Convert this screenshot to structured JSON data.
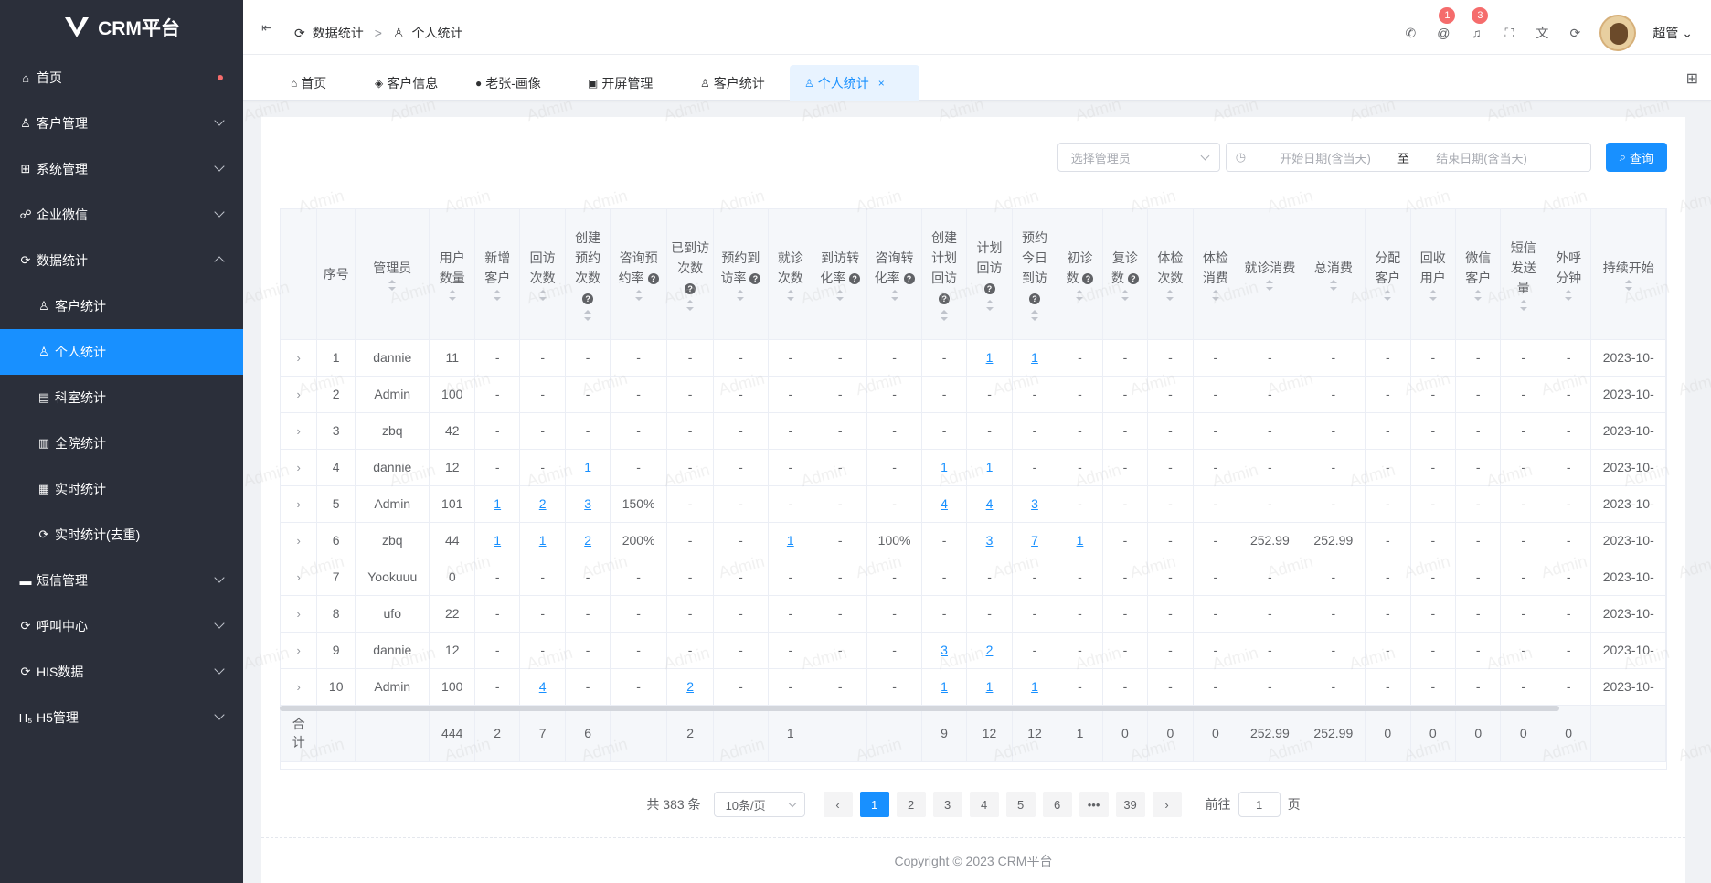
{
  "app": {
    "title": "CRM平台"
  },
  "sidebar": {
    "items": [
      {
        "label": "首页",
        "icon": "home-icon",
        "glyph": "⌂"
      },
      {
        "label": "客户管理",
        "icon": "user-icon",
        "glyph": "♙"
      },
      {
        "label": "系统管理",
        "icon": "grid-icon",
        "glyph": "⊞"
      },
      {
        "label": "企业微信",
        "icon": "chat-icon",
        "glyph": "☍"
      },
      {
        "label": "数据统计",
        "icon": "refresh-icon",
        "glyph": "⟳"
      },
      {
        "label": "客户统计",
        "icon": "user-icon",
        "glyph": "♙"
      },
      {
        "label": "个人统计",
        "icon": "user-icon",
        "glyph": "♙"
      },
      {
        "label": "科室统计",
        "icon": "building-icon",
        "glyph": "▤"
      },
      {
        "label": "全院统计",
        "icon": "hospital-icon",
        "glyph": "▥"
      },
      {
        "label": "实时统计",
        "icon": "chart-icon",
        "glyph": "▦"
      },
      {
        "label": "实时统计(去重)",
        "icon": "refresh-icon",
        "glyph": "⟳"
      },
      {
        "label": "短信管理",
        "icon": "message-icon",
        "glyph": "▬"
      },
      {
        "label": "呼叫中心",
        "icon": "refresh-icon",
        "glyph": "⟳"
      },
      {
        "label": "HIS数据",
        "icon": "refresh-icon",
        "glyph": "⟳"
      },
      {
        "label": "H5管理",
        "icon": "h5-icon",
        "glyph": "H₅"
      }
    ]
  },
  "header": {
    "breadcrumb": [
      "数据统计",
      "个人统计"
    ],
    "breadcrumb_sep": ">",
    "badges": {
      "at": "1",
      "bell": "3"
    },
    "user": "超管"
  },
  "tabs": [
    {
      "label": "首页",
      "icon": "⌂"
    },
    {
      "label": "客户信息",
      "icon": "◈"
    },
    {
      "label": "老张-画像",
      "icon": "●"
    },
    {
      "label": "开屏管理",
      "icon": "▣"
    },
    {
      "label": "客户统计",
      "icon": "♙"
    },
    {
      "label": "个人统计",
      "icon": "♙"
    }
  ],
  "tab_close": "×",
  "filters": {
    "manager_placeholder": "选择管理员",
    "start_placeholder": "开始日期(含当天)",
    "date_sep": "至",
    "end_placeholder": "结束日期(含当天)",
    "query_label": "查询",
    "query_icon": "⌕"
  },
  "table": {
    "headers": [
      "",
      "序号",
      "管理员",
      "用户数量",
      "新增客户",
      "回访次数",
      "创建预约次数",
      "咨询预约率",
      "已到访次数",
      "预约到访率",
      "就诊次数",
      "到访转化率",
      "咨询转化率",
      "创建计划回访",
      "计划回访",
      "预约今日到访",
      "初诊数",
      "复诊数",
      "体检次数",
      "体检消费",
      "就诊消费",
      "总消费",
      "分配客户",
      "回收用户",
      "微信客户",
      "短信发送量",
      "外呼分钟",
      "持续开始"
    ],
    "help_cols": [
      6,
      7,
      8,
      9,
      11,
      12,
      13,
      14,
      15,
      16,
      17
    ],
    "rows": [
      [
        "1",
        "dannie",
        "11",
        "-",
        "-",
        "-",
        "-",
        "-",
        "-",
        "-",
        "-",
        "-",
        "-",
        "1",
        "1",
        "-",
        "-",
        "-",
        "-",
        "-",
        "-",
        "-",
        "-",
        "-",
        "-",
        "-",
        "2023-10-"
      ],
      [
        "2",
        "Admin",
        "100",
        "-",
        "-",
        "-",
        "-",
        "-",
        "-",
        "-",
        "-",
        "-",
        "-",
        "-",
        "-",
        "-",
        "-",
        "-",
        "-",
        "-",
        "-",
        "-",
        "-",
        "-",
        "-",
        "-",
        "2023-10-"
      ],
      [
        "3",
        "zbq",
        "42",
        "-",
        "-",
        "-",
        "-",
        "-",
        "-",
        "-",
        "-",
        "-",
        "-",
        "-",
        "-",
        "-",
        "-",
        "-",
        "-",
        "-",
        "-",
        "-",
        "-",
        "-",
        "-",
        "-",
        "2023-10-"
      ],
      [
        "4",
        "dannie",
        "12",
        "-",
        "-",
        "1",
        "-",
        "-",
        "-",
        "-",
        "-",
        "-",
        "1",
        "1",
        "-",
        "-",
        "-",
        "-",
        "-",
        "-",
        "-",
        "-",
        "-",
        "-",
        "-",
        "-",
        "2023-10-"
      ],
      [
        "5",
        "Admin",
        "101",
        "1",
        "2",
        "3",
        "150%",
        "-",
        "-",
        "-",
        "-",
        "-",
        "4",
        "4",
        "3",
        "-",
        "-",
        "-",
        "-",
        "-",
        "-",
        "-",
        "-",
        "-",
        "-",
        "-",
        "2023-10-"
      ],
      [
        "6",
        "zbq",
        "44",
        "1",
        "1",
        "2",
        "200%",
        "-",
        "-",
        "1",
        "-",
        "100%",
        "-",
        "3",
        "7",
        "1",
        "-",
        "-",
        "-",
        "252.99",
        "252.99",
        "-",
        "-",
        "-",
        "-",
        "-",
        "2023-10-"
      ],
      [
        "7",
        "Yookuuu",
        "0",
        "-",
        "-",
        "-",
        "-",
        "-",
        "-",
        "-",
        "-",
        "-",
        "-",
        "-",
        "-",
        "-",
        "-",
        "-",
        "-",
        "-",
        "-",
        "-",
        "-",
        "-",
        "-",
        "-",
        "2023-10-"
      ],
      [
        "8",
        "ufo",
        "22",
        "-",
        "-",
        "-",
        "-",
        "-",
        "-",
        "-",
        "-",
        "-",
        "-",
        "-",
        "-",
        "-",
        "-",
        "-",
        "-",
        "-",
        "-",
        "-",
        "-",
        "-",
        "-",
        "-",
        "2023-10-"
      ],
      [
        "9",
        "dannie",
        "12",
        "-",
        "-",
        "-",
        "-",
        "-",
        "-",
        "-",
        "-",
        "-",
        "3",
        "2",
        "-",
        "-",
        "-",
        "-",
        "-",
        "-",
        "-",
        "-",
        "-",
        "-",
        "-",
        "-",
        "2023-10-"
      ],
      [
        "10",
        "Admin",
        "100",
        "-",
        "4",
        "-",
        "-",
        "2",
        "-",
        "-",
        "-",
        "-",
        "1",
        "1",
        "1",
        "-",
        "-",
        "-",
        "-",
        "-",
        "-",
        "-",
        "-",
        "-",
        "-",
        "-",
        "2023-10-"
      ]
    ],
    "summary": [
      "合计",
      "",
      "",
      "444",
      "2",
      "7",
      "6",
      "",
      "2",
      "",
      "1",
      "",
      "",
      "9",
      "12",
      "12",
      "1",
      "0",
      "0",
      "0",
      "252.99",
      "252.99",
      "0",
      "0",
      "0",
      "0",
      "0",
      ""
    ]
  },
  "pagination": {
    "total": "共 383 条",
    "page_size": "10条/页",
    "pages": [
      "1",
      "2",
      "3",
      "4",
      "5",
      "6",
      "•••",
      "39"
    ],
    "prev": "‹",
    "next": "›",
    "goto_prefix": "前往",
    "goto_value": "1",
    "goto_suffix": "页"
  },
  "footer": {
    "copyright": "Copyright © 2023 CRM平台"
  },
  "watermark": "Admin",
  "colors": {
    "accent": "#1890ff",
    "sidebar": "#2b2f3a",
    "badge": "#f56c6c"
  }
}
